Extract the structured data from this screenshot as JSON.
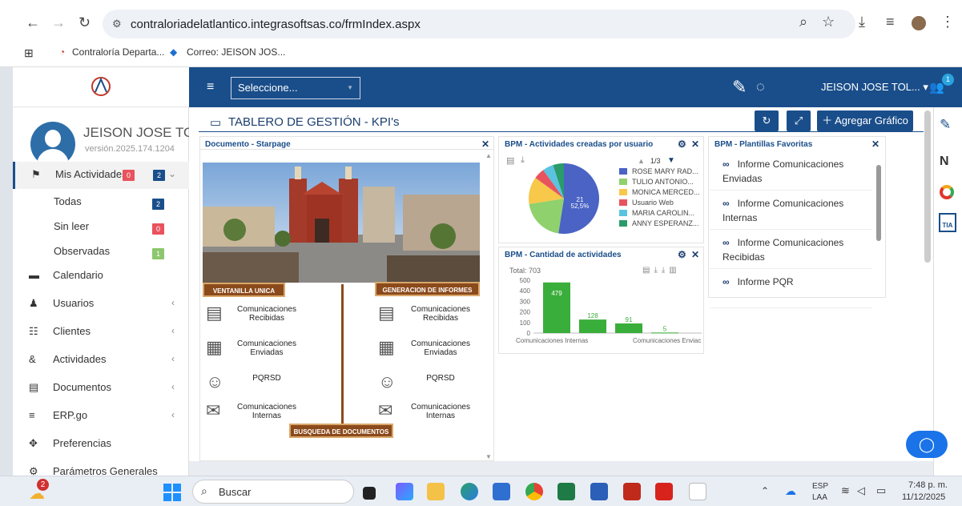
{
  "browser": {
    "url": "contraloriadelatlantico.integrasoftsas.co/frmIndex.aspx",
    "bookmarks": [
      "Contraloría Departa...",
      "Correo: JEISON JOS..."
    ]
  },
  "header": {
    "select_placeholder": "Seleccione...",
    "user_name": "JEISON JOSE TOL...",
    "notif_count": "1"
  },
  "profile": {
    "name": "JEISON JOSE TO",
    "version": "versión.2025.174.1204"
  },
  "sidebar": {
    "my_activities": {
      "label": "Mis Actividades",
      "badge_red": "0",
      "badge_blue": "2"
    },
    "subitems": [
      {
        "label": "Todas",
        "badge": "2",
        "color": "#1a4e8a"
      },
      {
        "label": "Sin leer",
        "badge": "0",
        "color": "#e8535d"
      },
      {
        "label": "Observadas",
        "badge": "1",
        "color": "#8cc66d"
      }
    ],
    "items": [
      {
        "label": "Calendario",
        "icon": "calendar-icon",
        "chev": ""
      },
      {
        "label": "Usuarios",
        "icon": "user-icon",
        "chev": "‹"
      },
      {
        "label": "Clientes",
        "icon": "users-icon",
        "chev": "‹"
      },
      {
        "label": "Actividades",
        "icon": "activities-icon",
        "chev": "‹"
      },
      {
        "label": "Documentos",
        "icon": "file-icon",
        "chev": "‹"
      },
      {
        "label": "ERP.go",
        "icon": "menu-icon",
        "chev": "‹"
      },
      {
        "label": "Preferencias",
        "icon": "move-icon",
        "chev": ""
      },
      {
        "label": "Parámetros Generales",
        "icon": "settings-icon",
        "chev": ""
      }
    ]
  },
  "main": {
    "title": "TABLERO DE GESTIÓN - KPI's",
    "add_chart": "Agregar Gráfico"
  },
  "panel_doc": {
    "title": "Documento - Starpage",
    "ventanilla": "VENTANILLA UNICA",
    "generacion": "GENERACION DE INFORMES",
    "busqueda": "BUSQUEDA DE DOCUMENTOS",
    "left_items": [
      "Comunicaciones Recibidas",
      "Comunicaciones Enviadas",
      "PQRSD",
      "Comunicaciones Internas"
    ],
    "right_items": [
      "Comunicaciones Recibidas",
      "Comunicaciones Enviadas",
      "PQRSD",
      "Comunicaciones Internas"
    ]
  },
  "panel_pie": {
    "title": "BPM - Actividades creadas por usuario",
    "pager": "1/3",
    "slice_label_value": "21",
    "slice_label_pct": "52,5%"
  },
  "panel_bar": {
    "title": "BPM - Cantidad de actividades",
    "total": "Total: 703"
  },
  "panel_fav": {
    "title": "BPM - Plantillas Favoritas",
    "items": [
      "Informe Comunicaciones Enviadas",
      "Informe Comunicaciones Internas",
      "Informe Comunicaciones Recibidas",
      "Informe PQR"
    ]
  },
  "taskbar": {
    "search": "Buscar",
    "lang1": "ESP",
    "lang2": "LAA",
    "time": "7:48 p. m.",
    "date": "11/12/2025",
    "weather_badge": "2"
  },
  "chart_data": [
    {
      "type": "pie",
      "title": "BPM - Actividades creadas por usuario",
      "categories": [
        "ROSE MARY RAD...",
        "TULIO ANTONIO...",
        "MONICA MERCED...",
        "Usuario Web",
        "MARIA CAROLIN...",
        "ANNY ESPERANZ..."
      ],
      "values": [
        21,
        8,
        5,
        2,
        2,
        2
      ],
      "colors": [
        "#4a63c4",
        "#8fd16d",
        "#f7c84a",
        "#e8535d",
        "#5bc2e0",
        "#2a9b6b"
      ],
      "legend": "right"
    },
    {
      "type": "bar",
      "title": "BPM - Cantidad de actividades",
      "categories": [
        "Comunicaciones Internas",
        "",
        "Comunicaciones Enviadas",
        ""
      ],
      "tick_labels": [
        "Comunicaciones Internas",
        "Comunicaciones Enviac"
      ],
      "values": [
        479,
        128,
        91,
        5
      ],
      "yticks": [
        "500",
        "400",
        "300",
        "200",
        "100",
        "0"
      ],
      "ylim": [
        0,
        500
      ],
      "color": "#3aae3a"
    }
  ]
}
